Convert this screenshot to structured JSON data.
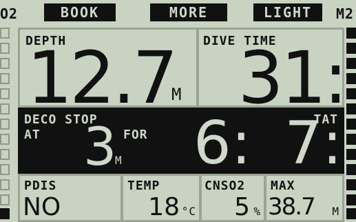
{
  "top_bar": {
    "left_indicator": "O2",
    "book_label": "BOOK",
    "more_label": "MORE",
    "light_label": "LIGHT",
    "right_indicator": "M2"
  },
  "depth": {
    "label": "DEPTH",
    "value": "12.7",
    "unit": "M"
  },
  "dive_time": {
    "label": "DIVE TIME",
    "value": "31:"
  },
  "deco": {
    "label": "DECO STOP",
    "at_label": "AT",
    "stop_depth": "3",
    "stop_depth_unit": "M",
    "for_label": "FOR",
    "stop_time": "6:",
    "tat_label": "TAT",
    "tat_value": "7:"
  },
  "bottom": {
    "pdis_label": "PDIS",
    "pdis_value": "NO",
    "temp_label": "TEMP",
    "temp_value": "18",
    "temp_unit": "°C",
    "cns_label": "CNSO2",
    "cns_value": "5",
    "cns_unit": "%",
    "max_label": "MAX",
    "max_value": "38.7",
    "max_unit": "M"
  },
  "colors": {
    "lcd_background": "#c9d3c2",
    "segment_dark": "#111111"
  }
}
